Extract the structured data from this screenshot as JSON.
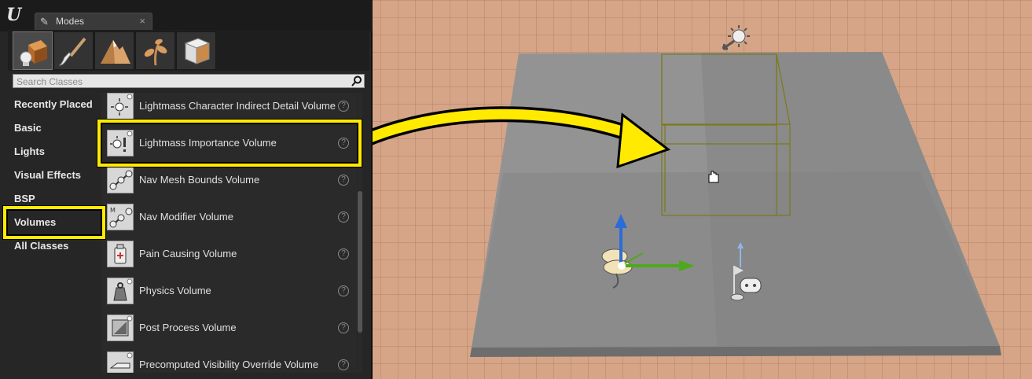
{
  "panel": {
    "tab_title": "Modes",
    "close_glyph": "×",
    "search_placeholder": "Search Classes",
    "modes": [
      {
        "name": "place-mode",
        "icon": "place-icon",
        "active": true
      },
      {
        "name": "paint-mode",
        "icon": "paint-brush-icon",
        "active": false
      },
      {
        "name": "landscape-mode",
        "icon": "landscape-icon",
        "active": false
      },
      {
        "name": "foliage-mode",
        "icon": "foliage-icon",
        "active": false
      },
      {
        "name": "geometry-mode",
        "icon": "geometry-icon",
        "active": false
      }
    ],
    "categories": [
      "Recently Placed",
      "Basic",
      "Lights",
      "Visual Effects",
      "BSP",
      "Volumes",
      "All Classes"
    ],
    "selected_category": "Volumes",
    "classes": [
      {
        "label": "Lightmass Character Indirect Detail Volume",
        "icon": "lightmass-icon"
      },
      {
        "label": "Lightmass Importance Volume",
        "icon": "lightmass-importance-icon"
      },
      {
        "label": "Nav Mesh Bounds Volume",
        "icon": "nav-mesh-icon"
      },
      {
        "label": "Nav Modifier Volume",
        "icon": "nav-modifier-icon"
      },
      {
        "label": "Pain Causing Volume",
        "icon": "pain-causing-icon"
      },
      {
        "label": "Physics Volume",
        "icon": "physics-icon"
      },
      {
        "label": "Post Process Volume",
        "icon": "post-process-icon"
      },
      {
        "label": "Precomputed Visibility Override Volume",
        "icon": "visibility-override-icon"
      }
    ],
    "highlighted_class": "Lightmass Importance Volume",
    "help_glyph": "?"
  },
  "colors": {
    "highlight": "#ffea00",
    "viewport_bg": "#d6a587",
    "floor": "#8c8c8c"
  }
}
